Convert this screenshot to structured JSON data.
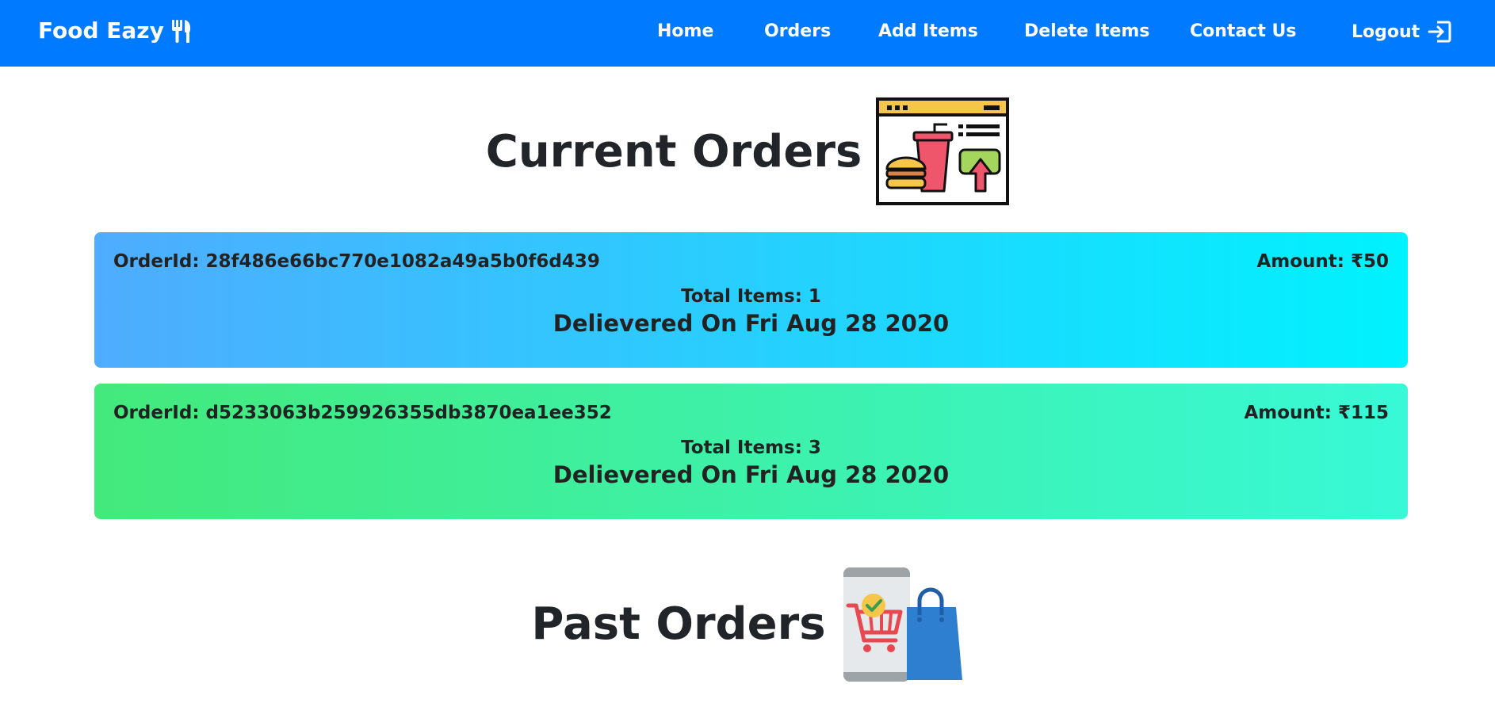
{
  "navbar": {
    "brand": "Food Eazy",
    "brand_icon": "utensils-icon",
    "links": {
      "home": "Home",
      "orders": "Orders",
      "add_items": "Add Items",
      "delete_items": "Delete Items",
      "contact_us": "Contact Us",
      "logout": "Logout"
    },
    "logout_icon": "sign-out-icon",
    "bg_color": "#007bff"
  },
  "current_orders": {
    "title": "Current Orders",
    "icon": "food-order-icon",
    "orders": [
      {
        "order_id": "OrderId: 28f486e66bc770e1082a49a5b0f6d439",
        "amount": "Amount: ₹50",
        "total_items": "Total Items: 1",
        "delivered": "Delievered On Fri Aug 28 2020",
        "gradient": [
          "#4facfe",
          "#00f2fe"
        ]
      },
      {
        "order_id": "OrderId: d5233063b259926355db3870ea1ee352",
        "amount": "Amount: ₹115",
        "total_items": "Total Items: 3",
        "delivered": "Delievered On Fri Aug 28 2020",
        "gradient": [
          "#43e97b",
          "#38f9d7"
        ]
      }
    ]
  },
  "past_orders": {
    "title": "Past Orders",
    "icon": "shopping-icon"
  }
}
